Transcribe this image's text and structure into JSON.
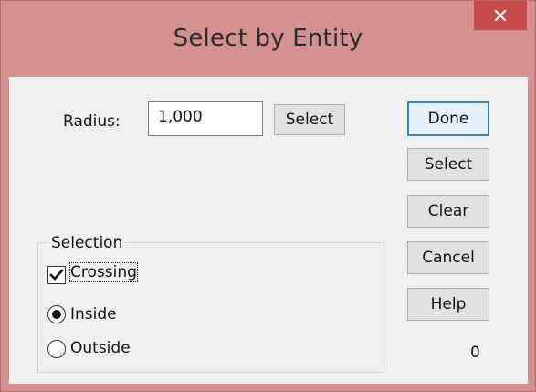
{
  "window": {
    "title": "Select by Entity",
    "close_glyph": "✕"
  },
  "radius": {
    "label": "Radius:",
    "value": "1,000",
    "select_button": "Select"
  },
  "buttons": {
    "done": "Done",
    "select": "Select",
    "clear": "Clear",
    "cancel": "Cancel",
    "help": "Help"
  },
  "selection": {
    "group_label": "Selection",
    "crossing_label": "Crossing",
    "crossing_checked": true,
    "inside_label": "Inside",
    "outside_label": "Outside",
    "selected_option": "Inside"
  },
  "count": "0",
  "colors": {
    "frame": "#d49190",
    "close_button": "#c74a4a",
    "client": "#f0f0f0",
    "default_button_border": "#3c7fb1"
  },
  "icons": {
    "close": "close-icon",
    "check": "checkmark-icon",
    "radio": "radio-dot-icon"
  }
}
